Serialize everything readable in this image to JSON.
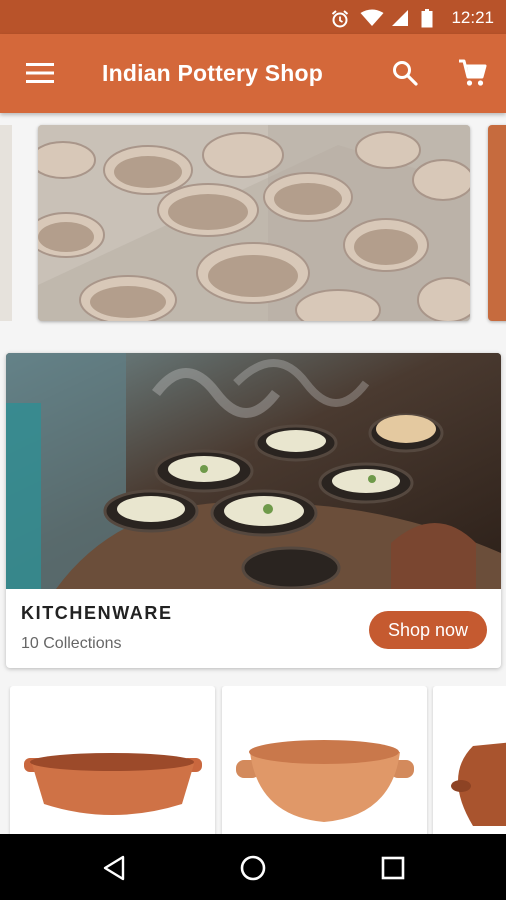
{
  "status_bar": {
    "time": "12:21",
    "icons": [
      "alarm-icon",
      "wifi-icon",
      "signal-icon",
      "battery-icon"
    ]
  },
  "app_bar": {
    "title": "Indian Pottery Shop",
    "menu_icon": "menu-icon",
    "search_icon": "search-icon",
    "cart_icon": "cart-icon",
    "background_color": "#d4683a"
  },
  "carousel": {
    "images": [
      "clay-cups-on-rack",
      "terracotta-item"
    ]
  },
  "category": {
    "name": "KITCHENWARE",
    "count": "10 Collections",
    "button_label": "Shop now",
    "button_color": "#c55a30"
  },
  "products": [
    {
      "image": "clay-cooking-pot"
    },
    {
      "image": "clay-kadai"
    },
    {
      "image": "clay-handi"
    }
  ],
  "nav_bar": {
    "buttons": [
      "back-icon",
      "home-icon",
      "recents-icon"
    ]
  }
}
